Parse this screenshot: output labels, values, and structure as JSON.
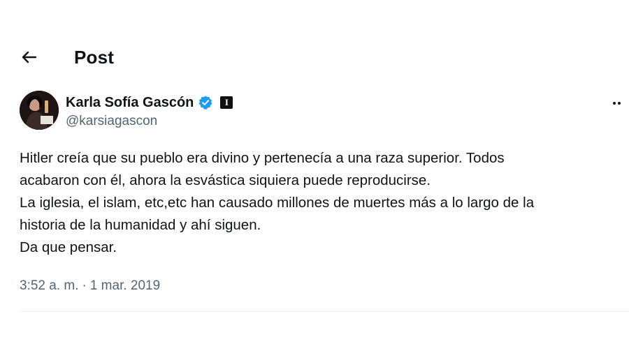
{
  "header": {
    "back_icon": "arrow-left-icon",
    "title": "Post"
  },
  "author": {
    "name": "Karla Sofía Gascón",
    "handle": "@karsiagascon",
    "verified_icon": "verified-badge-icon",
    "verified_color": "#1d9bf0",
    "affiliate_badge": "I",
    "more_icon": "more-options-icon"
  },
  "tweet": {
    "lines": [
      "Hitler creía que su pueblo era divino y pertenecía a una raza superior. Todos",
      "acabaron con él, ahora la esvástica siquiera puede reproducirse.",
      "La iglesia, el islam, etc,etc han causado millones de muertes más a lo largo de la",
      "historia de la humanidad y ahí siguen.",
      "Da que pensar."
    ]
  },
  "meta": {
    "time": "3:52 a. m.",
    "separator": "·",
    "date": "1 mar. 2019"
  }
}
